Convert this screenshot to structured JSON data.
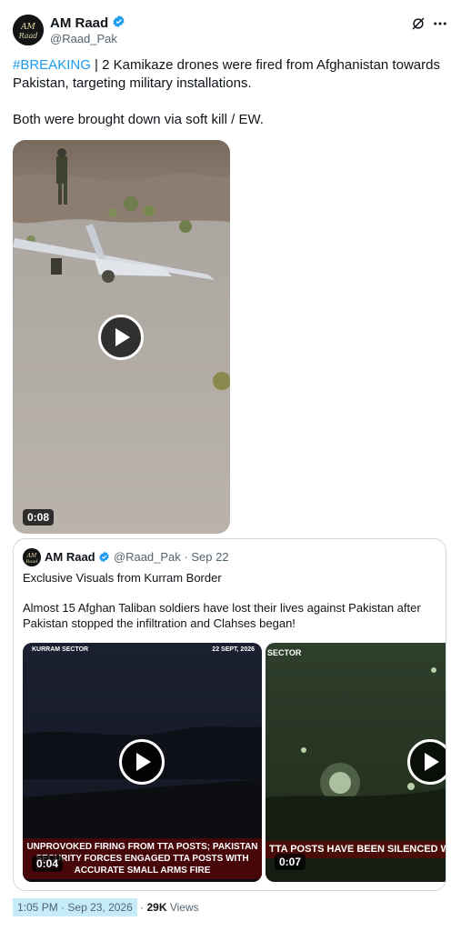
{
  "author": {
    "name": "AM Raad",
    "handle": "@Raad_Pak",
    "avatar_text": "AM Raad"
  },
  "post": {
    "hashtag": "#BREAKING",
    "line1_rest": " | 2 Kamikaze drones were fired from Afghanistan towards Pakistan, targeting military installations.",
    "line2": "Both were brought down via soft kill / EW.",
    "video_duration": "0:08"
  },
  "quoted": {
    "name": "AM Raad",
    "handle": "@Raad_Pak",
    "separator": "·",
    "date": "Sep 22",
    "text1": "Exclusive Visuals from Kurram Border",
    "text2": "Almost 15 Afghan Taliban soldiers have lost their lives against Pakistan after Pakistan stopped the infiltration and Clahses began!",
    "video1": {
      "tag_left": "KURRAM SECTOR",
      "tag_right": "22 SEPT, 2026",
      "caption": "UNPROVOKED FIRING FROM TTA POSTS; PAKISTAN SECURITY FORCES ENGAGED TTA POSTS WITH ACCURATE SMALL ARMS FIRE",
      "duration": "0:04"
    },
    "video2": {
      "tag_left": "SECTOR",
      "caption": "TTA POSTS HAVE BEEN SILENCED WITH FIRE. STOP HARBOURING TERRORISTS AND F",
      "duration": "0:07"
    }
  },
  "meta": {
    "time": "1:05 PM",
    "separator": "·",
    "date": "Sep 23, 2026",
    "views_count": "29K",
    "views_label": "Views"
  },
  "icons": {
    "verified": "verified-badge-icon",
    "grok": "grok-icon",
    "more": "more-icon",
    "play": "play-icon"
  },
  "colors": {
    "accent": "#1d9bf0",
    "text": "#0f1419",
    "muted": "#536471",
    "highlight": "#c6ecf9"
  }
}
